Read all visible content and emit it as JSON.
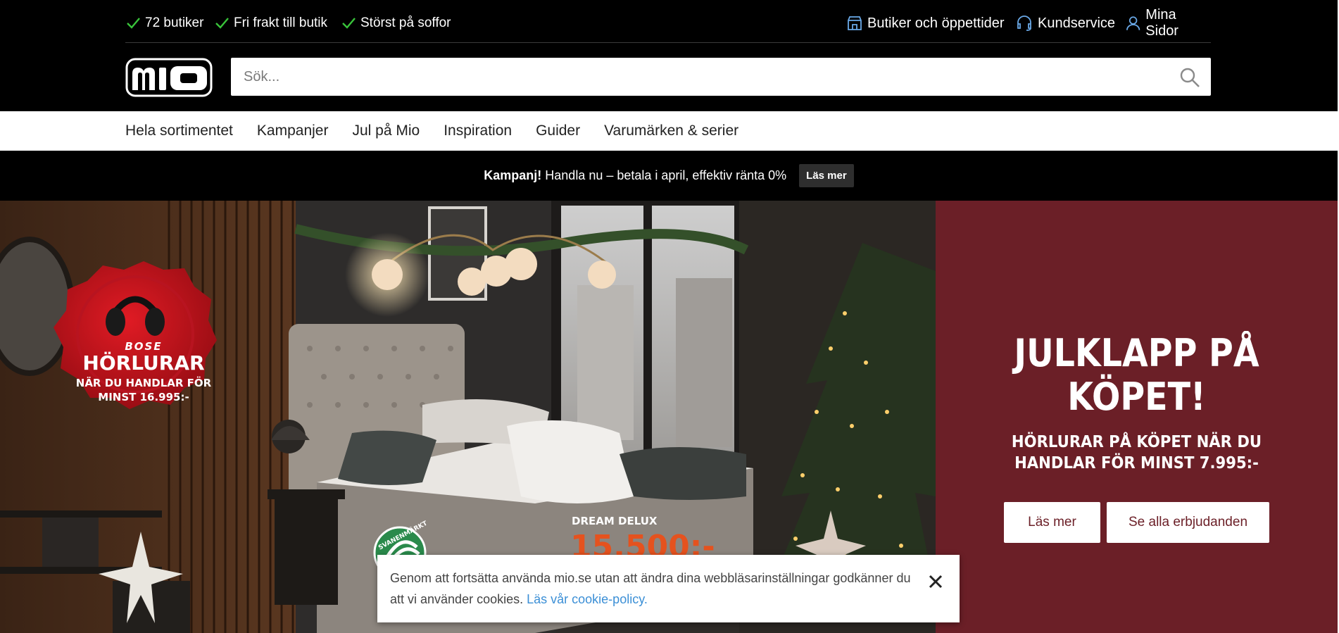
{
  "usps": [
    "72 butiker",
    "Fri frakt till butik",
    "Störst på soffor"
  ],
  "utility_links": {
    "stores": "Butiker och öppettider",
    "support": "Kundservice",
    "account": "Mina Sidor"
  },
  "brand": {
    "logo_text": "mio"
  },
  "search": {
    "placeholder": "Sök..."
  },
  "nav": [
    "Hela sortimentet",
    "Kampanjer",
    "Jul på Mio",
    "Inspiration",
    "Guider",
    "Varumärken & serier"
  ],
  "promo": {
    "label": "Kampanj!",
    "text": "Handla nu – betala i april, effektiv ränta 0%",
    "button": "Läs mer"
  },
  "hero": {
    "title_line1": "JULKLAPP PÅ",
    "title_line2": "KÖPET!",
    "subtitle": "HÖRLURAR PÅ KÖPET NÄR DU HANDLAR FÖR MINST 7.995:-",
    "button_primary": "Läs mer",
    "button_secondary": "Se alla erbjudanden",
    "panel_color": "#6b1f27"
  },
  "seal": {
    "brand": "BOSE",
    "title": "HÖRLURAR",
    "line1": "NÄR DU HANDLAR FÖR",
    "line2": "MINST 16.995:-"
  },
  "eco_label": "SVANENMÄRKT",
  "product": {
    "name": "DREAM DELUX",
    "price": "15.500:-"
  },
  "cookie": {
    "text": "Genom att fortsätta använda mio.se utan att ändra dina webbläsarinställningar godkänner du att vi använder cookies.",
    "link": "Läs vår cookie-policy."
  }
}
